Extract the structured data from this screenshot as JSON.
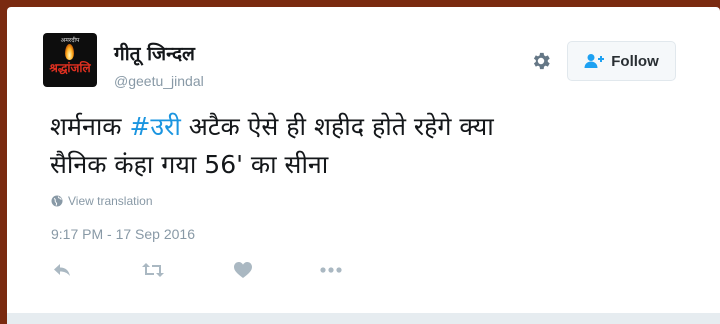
{
  "user": {
    "display_name": "गीतू जिन्दल",
    "handle": "@geetu_jindal",
    "avatar_top_text": "अमरदीप",
    "avatar_mid_text": "श्रद्धांजलि"
  },
  "follow_button": {
    "label": "Follow"
  },
  "tweet": {
    "line1_before": "शर्मनाक ",
    "hashtag": "#उरी",
    "line1_after": " अटैक ऐसे ही शहीद होते रहेगे क्या",
    "line2": "सैनिक कंहा गया 56' का सीना"
  },
  "translation_link": "View translation",
  "timestamp": "9:17 PM - 17 Sep 2016",
  "icons": [
    "gear-icon",
    "follow-person-icon",
    "globe-icon",
    "reply-icon",
    "retweet-icon",
    "like-icon",
    "more-icon"
  ],
  "colors": {
    "accent": "#1da1f2",
    "hashtag": "#1b95e0",
    "muted": "#8899a6",
    "text": "#14171a"
  }
}
